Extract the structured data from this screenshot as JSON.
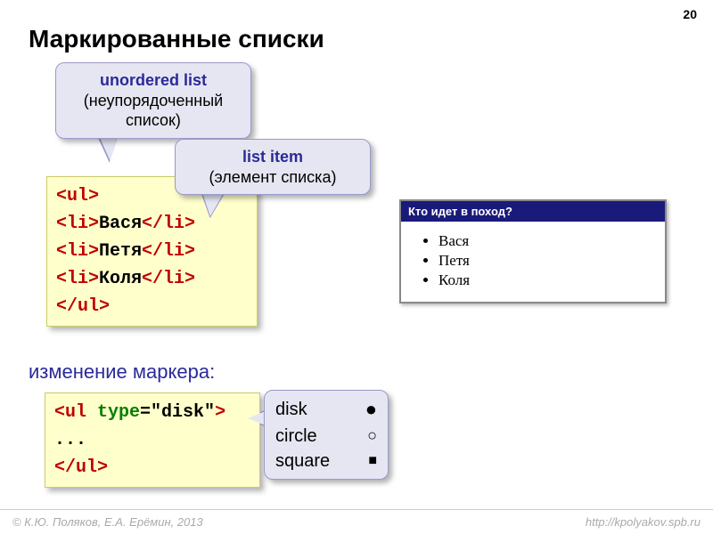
{
  "page_number": "20",
  "title": "Маркированные списки",
  "callout_ul": {
    "bold": "unordered list",
    "plain": "(неупорядоченный список)"
  },
  "callout_li": {
    "bold": "list item",
    "plain": "(элемент списка)"
  },
  "code1": {
    "open_ul": "<ul>",
    "li_open": "<li>",
    "li_close": "</li>",
    "items": [
      "Вася",
      "Петя",
      "Коля"
    ],
    "close_ul": "</ul>"
  },
  "subhead": "изменение маркера:",
  "code2": {
    "line1_open": "<ul ",
    "line1_attr": "type",
    "line1_eq": "=",
    "line1_val": "\"disk\"",
    "line1_close": ">",
    "line2": "...",
    "line3": "</ul>"
  },
  "markers": {
    "disk": "disk",
    "circle": "circle",
    "square": "square"
  },
  "browser": {
    "title": "Кто идет в поход?",
    "items": [
      "Вася",
      "Петя",
      "Коля"
    ]
  },
  "footer": {
    "left": "© К.Ю. Поляков, Е.А. Ерёмин, 2013",
    "right": "http://kpolyakov.spb.ru"
  }
}
